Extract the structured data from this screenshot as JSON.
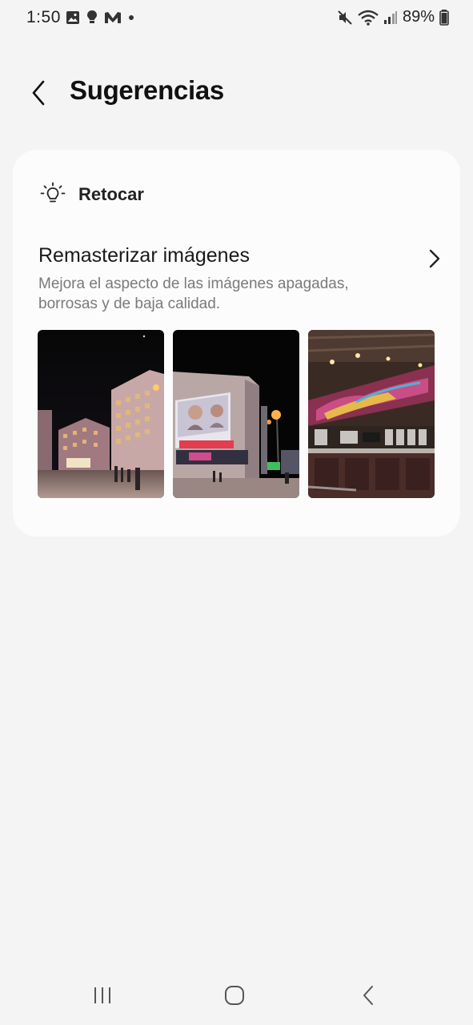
{
  "status_bar": {
    "time": "1:50",
    "battery": "89%"
  },
  "header": {
    "title": "Sugerencias"
  },
  "section": {
    "title": "Retocar",
    "icon": "lightbulb-icon"
  },
  "suggestion": {
    "title": "Remasterizar imágenes",
    "description": "Mejora el aspecto de las imágenes apagadas, borrosas y de baja calidad.",
    "thumbnails": [
      "night-square-photo",
      "cinema-billboard-photo",
      "bar-interior-photo"
    ]
  },
  "colors": {
    "background": "#f4f4f4",
    "card": "#fcfcfc",
    "secondary_text": "#7a7a7a"
  }
}
